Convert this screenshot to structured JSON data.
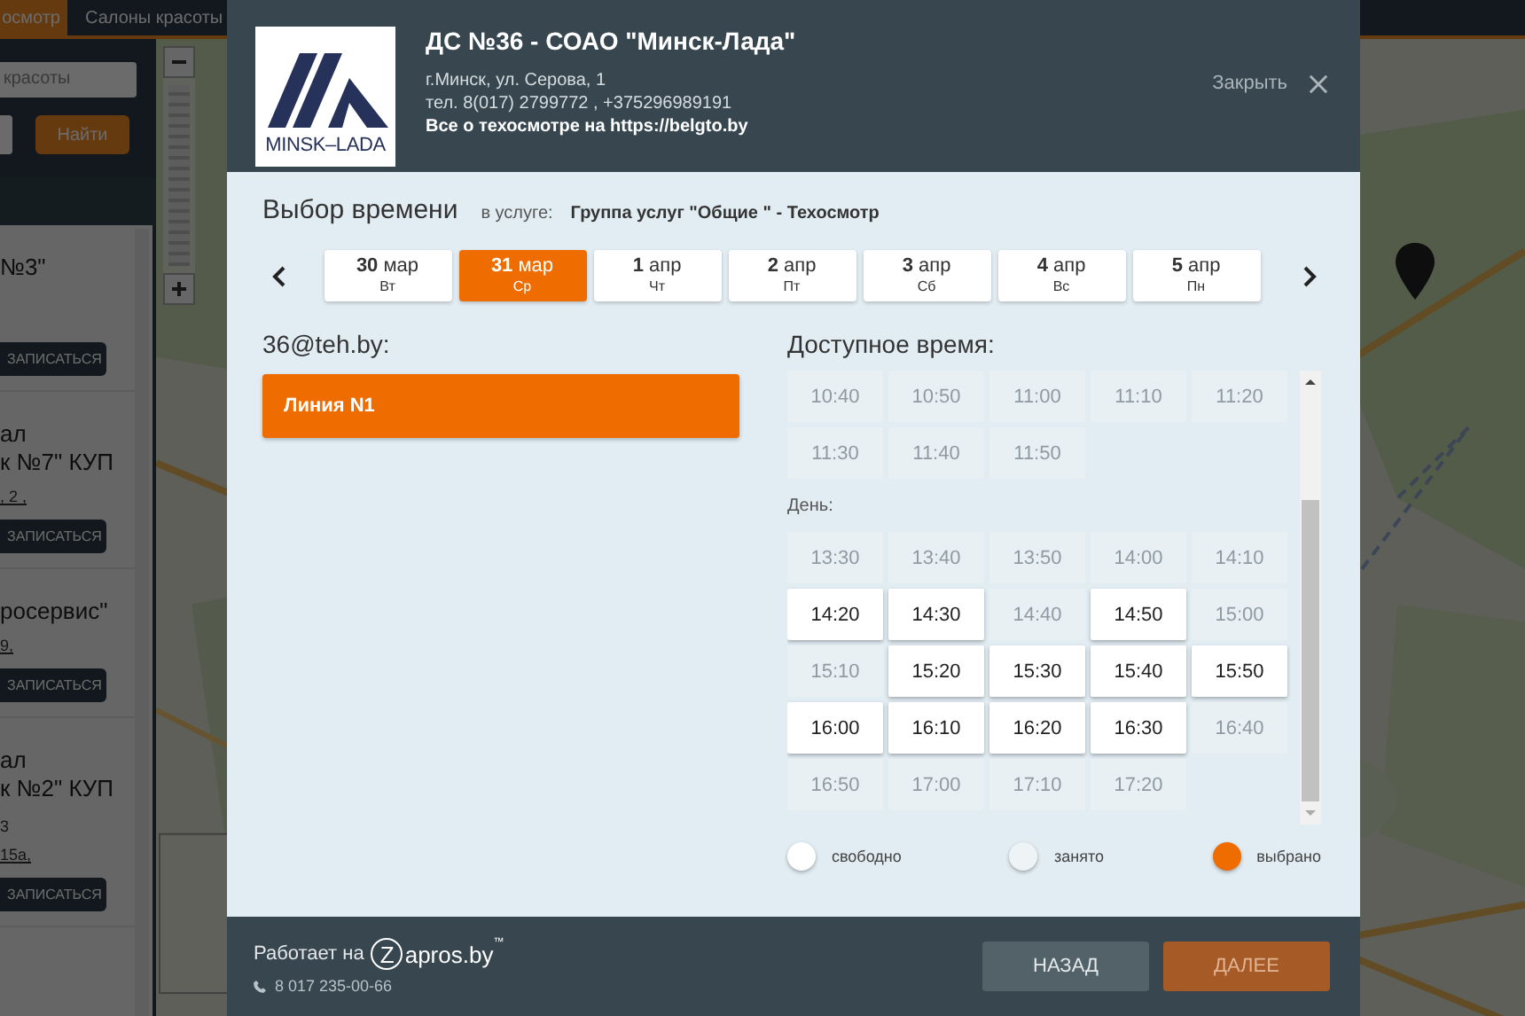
{
  "background_page": {
    "tabs": [
      {
        "label": "осмотр",
        "selected": true
      },
      {
        "label": "Салоны красоты",
        "selected": false
      }
    ],
    "search": {
      "value": "красоты"
    },
    "search_button": "Найти",
    "results": [
      {
        "lines": [
          "№3\""
        ],
        "button": "ЗАПИСАТЬСЯ"
      },
      {
        "lines": [
          "ал",
          "к №7\" КУП"
        ],
        "address": ", 2 ,",
        "button": "ЗАПИСАТЬСЯ"
      },
      {
        "lines": [
          "росервис\""
        ],
        "address": "9,",
        "button": "ЗАПИСАТЬСЯ"
      },
      {
        "lines": [
          "ал",
          "к №2\" КУП"
        ],
        "extra": "3",
        "address": "15а,",
        "button": "ЗАПИСАТЬСЯ"
      }
    ]
  },
  "dialog": {
    "logo_text": "MINSK–LADA",
    "title": "ДС №36 - СОАО \"Минск-Лада\"",
    "address": "г.Минск, ул. Серова, 1",
    "phone": "тел. 8(017) 2799772 , +375296989191",
    "info": "Все о техосмотре на https://belgto.by",
    "close": "Закрыть",
    "heading": "Выбор времени",
    "service_label": "в услуге:",
    "service": "Группа услуг \"Общие \" - Техосмотр",
    "dates": [
      {
        "day": "30",
        "month": "мар",
        "weekday": "Вт",
        "selected": false
      },
      {
        "day": "31",
        "month": "мар",
        "weekday": "Ср",
        "selected": true
      },
      {
        "day": "1",
        "month": "апр",
        "weekday": "Чт",
        "selected": false
      },
      {
        "day": "2",
        "month": "апр",
        "weekday": "Пт",
        "selected": false
      },
      {
        "day": "3",
        "month": "апр",
        "weekday": "Сб",
        "selected": false
      },
      {
        "day": "4",
        "month": "апр",
        "weekday": "Вс",
        "selected": false
      },
      {
        "day": "5",
        "month": "апр",
        "weekday": "Пн",
        "selected": false
      }
    ],
    "staff_title": "36@teh.by:",
    "lines": [
      {
        "label": "Линия N1",
        "selected": true
      }
    ],
    "available_title": "Доступное время:",
    "slot_groups": [
      {
        "slots": [
          {
            "time": "10:40",
            "free": false
          },
          {
            "time": "10:50",
            "free": false
          },
          {
            "time": "11:00",
            "free": false
          },
          {
            "time": "11:10",
            "free": false
          },
          {
            "time": "11:20",
            "free": false
          },
          {
            "time": "11:30",
            "free": false
          },
          {
            "time": "11:40",
            "free": false
          },
          {
            "time": "11:50",
            "free": false
          }
        ]
      },
      {
        "label": "День:",
        "slots": [
          {
            "time": "13:30",
            "free": false
          },
          {
            "time": "13:40",
            "free": false
          },
          {
            "time": "13:50",
            "free": false
          },
          {
            "time": "14:00",
            "free": false
          },
          {
            "time": "14:10",
            "free": false
          },
          {
            "time": "14:20",
            "free": true
          },
          {
            "time": "14:30",
            "free": true
          },
          {
            "time": "14:40",
            "free": false
          },
          {
            "time": "14:50",
            "free": true
          },
          {
            "time": "15:00",
            "free": false
          },
          {
            "time": "15:10",
            "free": false
          },
          {
            "time": "15:20",
            "free": true
          },
          {
            "time": "15:30",
            "free": true
          },
          {
            "time": "15:40",
            "free": true
          },
          {
            "time": "15:50",
            "free": true
          },
          {
            "time": "16:00",
            "free": true
          },
          {
            "time": "16:10",
            "free": true
          },
          {
            "time": "16:20",
            "free": true
          },
          {
            "time": "16:30",
            "free": true
          },
          {
            "time": "16:40",
            "free": false
          },
          {
            "time": "16:50",
            "free": false
          },
          {
            "time": "17:00",
            "free": false
          },
          {
            "time": "17:10",
            "free": false
          },
          {
            "time": "17:20",
            "free": false
          }
        ]
      }
    ],
    "legend": [
      {
        "label": "свободно",
        "kind": "free"
      },
      {
        "label": "занято",
        "kind": "busy"
      },
      {
        "label": "выбрано",
        "kind": "selected"
      }
    ],
    "powered_by": "Работает на",
    "brand_mark": "Z",
    "brand": "apros.by",
    "brand_tm": "™",
    "support_phone": "8 017 235-00-66",
    "buttons": [
      {
        "label": "НАЗАД",
        "kind": "back"
      },
      {
        "label": "ДАЛЕЕ",
        "kind": "next"
      }
    ]
  }
}
